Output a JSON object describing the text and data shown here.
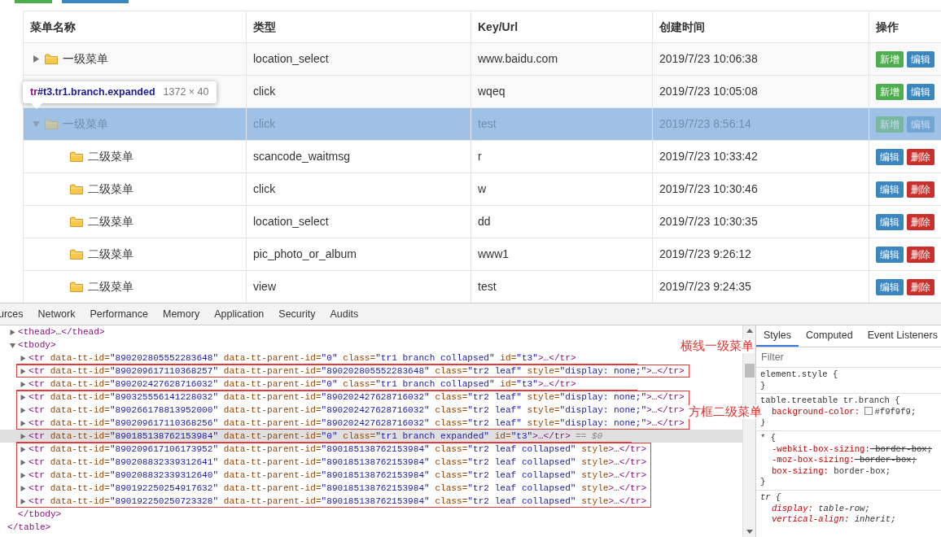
{
  "top_buttons": [
    {
      "kind": "add"
    },
    {
      "kind": "primary"
    }
  ],
  "table": {
    "columns": [
      "菜单名称",
      "类型",
      "Key/Url",
      "创建时间",
      "操作"
    ],
    "rows": [
      {
        "kind": "branch",
        "expanded": false,
        "highlighted": false,
        "name": "一级菜单",
        "type": "location_select",
        "key": "www.baidu.com",
        "time": "2019/7/23 10:06:38",
        "actions": [
          {
            "kind": "add",
            "label": "新增"
          },
          {
            "kind": "edit",
            "label": "编辑"
          }
        ]
      },
      {
        "kind": "branch",
        "highlighted": false,
        "type": "click",
        "key": "wqeq",
        "time": "2019/7/23 10:05:08",
        "actions": [
          {
            "kind": "add",
            "label": "新增"
          },
          {
            "kind": "edit",
            "label": "编辑"
          }
        ]
      },
      {
        "kind": "branch",
        "expanded": true,
        "highlighted": true,
        "name": "一级菜单",
        "type": "click",
        "key": "test",
        "time": "2019/7/23 8:56:14",
        "actions": [
          {
            "kind": "add",
            "label": "新增"
          },
          {
            "kind": "edit",
            "label": "编辑"
          }
        ]
      },
      {
        "kind": "leaf",
        "highlighted": false,
        "name": "二级菜单",
        "type": "scancode_waitmsg",
        "key": "r",
        "time": "2019/7/23 10:33:42",
        "actions": [
          {
            "kind": "edit",
            "label": "编辑"
          },
          {
            "kind": "delete",
            "label": "删除"
          }
        ]
      },
      {
        "kind": "leaf",
        "highlighted": false,
        "name": "二级菜单",
        "type": "click",
        "key": "w",
        "time": "2019/7/23 10:30:46",
        "actions": [
          {
            "kind": "edit",
            "label": "编辑"
          },
          {
            "kind": "delete",
            "label": "删除"
          }
        ]
      },
      {
        "kind": "leaf",
        "highlighted": false,
        "name": "二级菜单",
        "type": "location_select",
        "key": "dd",
        "time": "2019/7/23 10:30:35",
        "actions": [
          {
            "kind": "edit",
            "label": "编辑"
          },
          {
            "kind": "delete",
            "label": "删除"
          }
        ]
      },
      {
        "kind": "leaf",
        "highlighted": false,
        "name": "二级菜单",
        "type": "pic_photo_or_album",
        "key": "www1",
        "time": "2019/7/23 9:26:12",
        "actions": [
          {
            "kind": "edit",
            "label": "编辑"
          },
          {
            "kind": "delete",
            "label": "删除"
          }
        ]
      },
      {
        "kind": "leaf",
        "highlighted": false,
        "name": "二级菜单",
        "type": "view",
        "key": "test",
        "time": "2019/7/23 9:24:35",
        "actions": [
          {
            "kind": "edit",
            "label": "编辑"
          },
          {
            "kind": "delete",
            "label": "删除"
          }
        ]
      }
    ]
  },
  "tooltip": {
    "tag": "tr",
    "selector": "#t3.tr1.branch.expanded",
    "size": "1372 × 40"
  },
  "devtools": {
    "tabs": [
      "urces",
      "Network",
      "Performance",
      "Memory",
      "Application",
      "Security",
      "Audits"
    ],
    "dom": {
      "close_line": "</table>",
      "children": [
        {
          "expanded": false,
          "open": "<thead>",
          "content": "…",
          "close": "</thead>"
        },
        {
          "expanded": true,
          "open": "<tbody>",
          "close_line": "</tbody>",
          "children": [
            {
              "expanded": false,
              "kind": "underline",
              "selected": false,
              "open": "<tr",
              "attrs": [
                {
                  "name": "data-tt-id=",
                  "value": "\"890202805552283648\""
                },
                {
                  "name": "data-tt-parent-id=",
                  "value": "\"0\""
                },
                {
                  "name": "class=",
                  "value": "\"tr1 branch collapsed\""
                },
                {
                  "name": "id=",
                  "value": "\"t3\""
                }
              ],
              "close": ">…</tr>"
            },
            {
              "expanded": false,
              "kind": "box",
              "selected": false,
              "open": "<tr",
              "attrs": [
                {
                  "name": "data-tt-id=",
                  "value": "\"890209617110368257\""
                },
                {
                  "name": "data-tt-parent-id=",
                  "value": "\"890202805552283648\""
                },
                {
                  "name": "class=",
                  "value": "\"tr2 leaf\""
                },
                {
                  "name": "style=",
                  "value": "\"display: none;\""
                }
              ],
              "close": ">…</tr>"
            },
            {
              "expanded": false,
              "kind": "underline",
              "selected": false,
              "open": "<tr",
              "attrs": [
                {
                  "name": "data-tt-id=",
                  "value": "\"890202427628716032\""
                },
                {
                  "name": "data-tt-parent-id=",
                  "value": "\"0\""
                },
                {
                  "name": "class=",
                  "value": "\"tr1 branch collapsed\""
                },
                {
                  "name": "id=",
                  "value": "\"t3\""
                }
              ],
              "close": ">…</tr>"
            },
            {
              "expanded": false,
              "kind": "box",
              "selected": false,
              "open": "<tr",
              "attrs": [
                {
                  "name": "data-tt-id=",
                  "value": "\"890325556141228032\""
                },
                {
                  "name": "data-tt-parent-id=",
                  "value": "\"890202427628716032\""
                },
                {
                  "name": "class=",
                  "value": "\"tr2 leaf\""
                },
                {
                  "name": "style=",
                  "value": "\"display: none;\""
                }
              ],
              "close": ">…</tr>"
            },
            {
              "expanded": false,
              "kind": "box",
              "selected": false,
              "open": "<tr",
              "attrs": [
                {
                  "name": "data-tt-id=",
                  "value": "\"890266178813952000\""
                },
                {
                  "name": "data-tt-parent-id=",
                  "value": "\"890202427628716032\""
                },
                {
                  "name": "class=",
                  "value": "\"tr2 leaf\""
                },
                {
                  "name": "style=",
                  "value": "\"display: none;\""
                }
              ],
              "close": ">…</tr>"
            },
            {
              "expanded": false,
              "kind": "box",
              "selected": false,
              "open": "<tr",
              "attrs": [
                {
                  "name": "data-tt-id=",
                  "value": "\"890209617110368256\""
                },
                {
                  "name": "data-tt-parent-id=",
                  "value": "\"890202427628716032\""
                },
                {
                  "name": "class=",
                  "value": "\"tr2 leaf\""
                },
                {
                  "name": "style=",
                  "value": "\"display: none;\""
                }
              ],
              "close": ">…</tr>"
            },
            {
              "expanded": false,
              "kind": "underline",
              "selected": true,
              "open": "<tr",
              "attrs": [
                {
                  "name": "data-tt-id=",
                  "value": "\"890185138762153984\""
                },
                {
                  "name": "data-tt-parent-id=",
                  "value": "\"0\""
                },
                {
                  "name": "class=",
                  "value": "\"tr1 branch expanded\""
                },
                {
                  "name": "id=",
                  "value": "\"t3\""
                }
              ],
              "close": ">…</tr>",
              "console_ref": "== $0"
            },
            {
              "expanded": false,
              "kind": "box",
              "selected": false,
              "open": "<tr",
              "attrs": [
                {
                  "name": "data-tt-id=",
                  "value": "\"890209617106173952\""
                },
                {
                  "name": "data-tt-parent-id=",
                  "value": "\"890185138762153984\""
                },
                {
                  "name": "class=",
                  "value": "\"tr2 leaf collapsed\""
                },
                {
                  "name": "style"
                }
              ],
              "close": ">…</tr>"
            },
            {
              "expanded": false,
              "kind": "box",
              "selected": false,
              "open": "<tr",
              "attrs": [
                {
                  "name": "data-tt-id=",
                  "value": "\"890208832339312641\""
                },
                {
                  "name": "data-tt-parent-id=",
                  "value": "\"890185138762153984\""
                },
                {
                  "name": "class=",
                  "value": "\"tr2 leaf collapsed\""
                },
                {
                  "name": "style"
                }
              ],
              "close": ">…</tr>"
            },
            {
              "expanded": false,
              "kind": "box",
              "selected": false,
              "open": "<tr",
              "attrs": [
                {
                  "name": "data-tt-id=",
                  "value": "\"890208832339312640\""
                },
                {
                  "name": "data-tt-parent-id=",
                  "value": "\"890185138762153984\""
                },
                {
                  "name": "class=",
                  "value": "\"tr2 leaf collapsed\""
                },
                {
                  "name": "style"
                }
              ],
              "close": ">…</tr>"
            },
            {
              "expanded": false,
              "kind": "box",
              "selected": false,
              "open": "<tr",
              "attrs": [
                {
                  "name": "data-tt-id=",
                  "value": "\"890192250254917632\""
                },
                {
                  "name": "data-tt-parent-id=",
                  "value": "\"890185138762153984\""
                },
                {
                  "name": "class=",
                  "value": "\"tr2 leaf collapsed\""
                },
                {
                  "name": "style"
                }
              ],
              "close": ">…</tr>"
            },
            {
              "expanded": false,
              "kind": "box",
              "selected": false,
              "open": "<tr",
              "attrs": [
                {
                  "name": "data-tt-id=",
                  "value": "\"890192250250723328\""
                },
                {
                  "name": "data-tt-parent-id=",
                  "value": "\"890185138762153984\""
                },
                {
                  "name": "class=",
                  "value": "\"tr2 leaf collapsed\""
                },
                {
                  "name": "style"
                }
              ],
              "close": ">…</tr>"
            }
          ]
        }
      ]
    },
    "notes": [
      "横线一级菜单",
      "方框二级菜单"
    ],
    "side_tabs": [
      {
        "label": "Styles",
        "selected": true
      },
      {
        "label": "Computed",
        "selected": false
      },
      {
        "label": "Event Listeners",
        "selected": false
      }
    ],
    "filter": {
      "placeholder": "Filter"
    },
    "rules": [
      {
        "selector": "element.style {",
        "italic": false,
        "close": "}"
      },
      {
        "selector": "table.treetable tr.branch {",
        "italic": false,
        "close": "}",
        "decls": [
          {
            "prop": "background-color:",
            "value": "#f9f9f9;",
            "color": "#f9f9f9",
            "overridden": false
          }
        ]
      },
      {
        "selector": "* {",
        "italic": false,
        "close": "}",
        "decls": [
          {
            "prop": "-webkit-box-sizing:",
            "value": "border-box;",
            "overridden": true
          },
          {
            "prop": "-moz-box-sizing:",
            "value": "border-box;",
            "overridden": true
          },
          {
            "prop": "box-sizing:",
            "value": "border-box;",
            "overridden": false
          }
        ]
      },
      {
        "selector": "tr {",
        "italic": true,
        "decls": [
          {
            "prop": "display:",
            "value": "table-row;",
            "overridden": false
          },
          {
            "prop": "vertical-align:",
            "value": "inherit;",
            "overridden": false
          }
        ]
      }
    ]
  }
}
